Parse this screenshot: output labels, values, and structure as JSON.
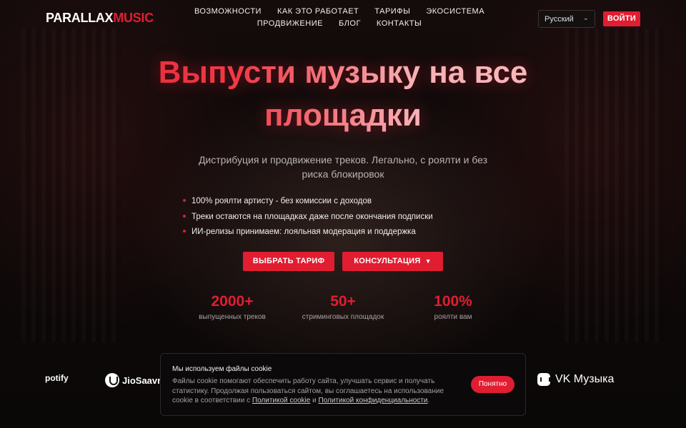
{
  "brand": {
    "logo_white": "PARALLAX",
    "logo_red": "MUSIC",
    "accent_color": "#e11d31"
  },
  "nav": {
    "items": [
      "ВОЗМОЖНОСТИ",
      "КАК ЭТО РАБОТАЕТ",
      "ТАРИФЫ",
      "ЭКОСИСТЕМА",
      "ПРОДВИЖЕНИЕ",
      "БЛОГ",
      "КОНТАКТЫ"
    ]
  },
  "header": {
    "language": "Русский",
    "login_label": "ВОЙТИ"
  },
  "hero": {
    "title_line1": "Выпусти музыку на все",
    "title_line2": "площадки",
    "subtitle": "Дистрибуция и продвижение треков. Легально, с роялти и без риска блокировок",
    "bullets": [
      "100% роялти артисту - без комиссии с доходов",
      "Треки остаются на площадках даже после окончания подписки",
      "ИИ-релизы принимаем: лояльная модерация и поддержка"
    ],
    "primary_button": "ВЫБРАТЬ ТАРИФ",
    "secondary_button": "КОНСУЛЬТАЦИЯ"
  },
  "stats": [
    {
      "value": "2000+",
      "label": "выпущенных треков"
    },
    {
      "value": "50+",
      "label": "стриминговых площадок"
    },
    {
      "value": "100%",
      "label": "роялти вам"
    }
  ],
  "partners": {
    "spotify": "potify",
    "jiosaavn": "JioSaavn",
    "vk": "VK Музыка"
  },
  "cookie": {
    "title": "Мы используем файлы cookie",
    "text_before": "Файлы cookie помогают обеспечить работу сайта, улучшать сервис и получать статистику. Продолжая пользоваться сайтом, вы соглашаетесь на использование cookie в соответствии с ",
    "link_cookie": "Политикой cookie",
    "text_middle": " и ",
    "link_privacy": "Политикой конфиденциальности",
    "text_after": ".",
    "accept_label": "Понятно"
  }
}
